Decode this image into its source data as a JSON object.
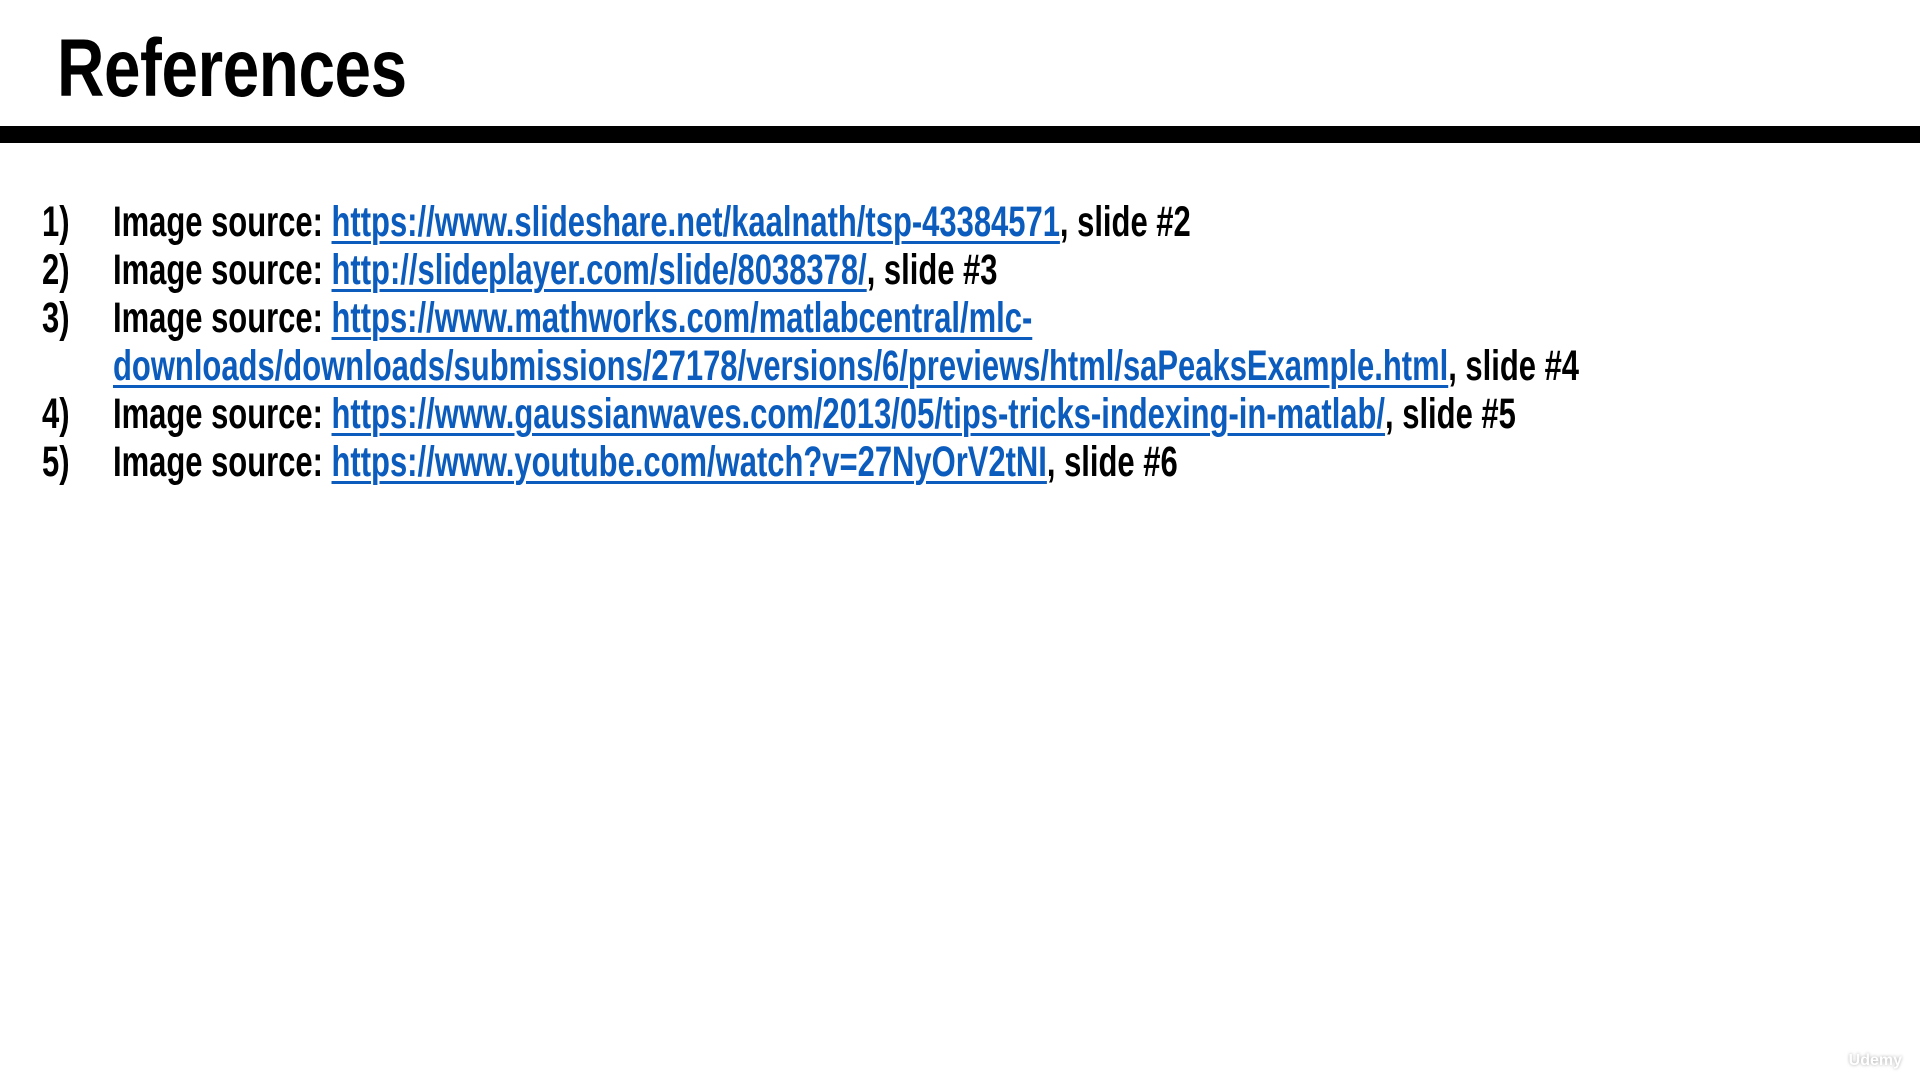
{
  "title": "References",
  "colors": {
    "link": "#0b5cbd",
    "text": "#000000",
    "rule": "#000000"
  },
  "references": [
    {
      "number": "1)",
      "prefix": "Image source: ",
      "link": "https://www.slideshare.net/kaalnath/tsp-43384571",
      "suffix": ", slide #2"
    },
    {
      "number": "2)",
      "prefix": "Image source: ",
      "link": "http://slideplayer.com/slide/8038378/",
      "suffix": ", slide #3"
    },
    {
      "number": "3)",
      "prefix": "Image source: ",
      "link": "https://www.mathworks.com/matlabcentral/mlc-",
      "link_cont": "downloads/downloads/submissions/27178/versions/6/previews/html/saPeaksExample.html",
      "suffix": ", slide #4"
    },
    {
      "number": "4)",
      "prefix": "Image source: ",
      "link": "https://www.gaussianwaves.com/2013/05/tips-tricks-indexing-in-matlab/",
      "suffix": ", slide #5"
    },
    {
      "number": "5)",
      "prefix": "Image source: ",
      "link": "https://www.youtube.com/watch?v=27NyOrV2tNI",
      "suffix": ", slide #6"
    }
  ],
  "watermark": "Udemy"
}
